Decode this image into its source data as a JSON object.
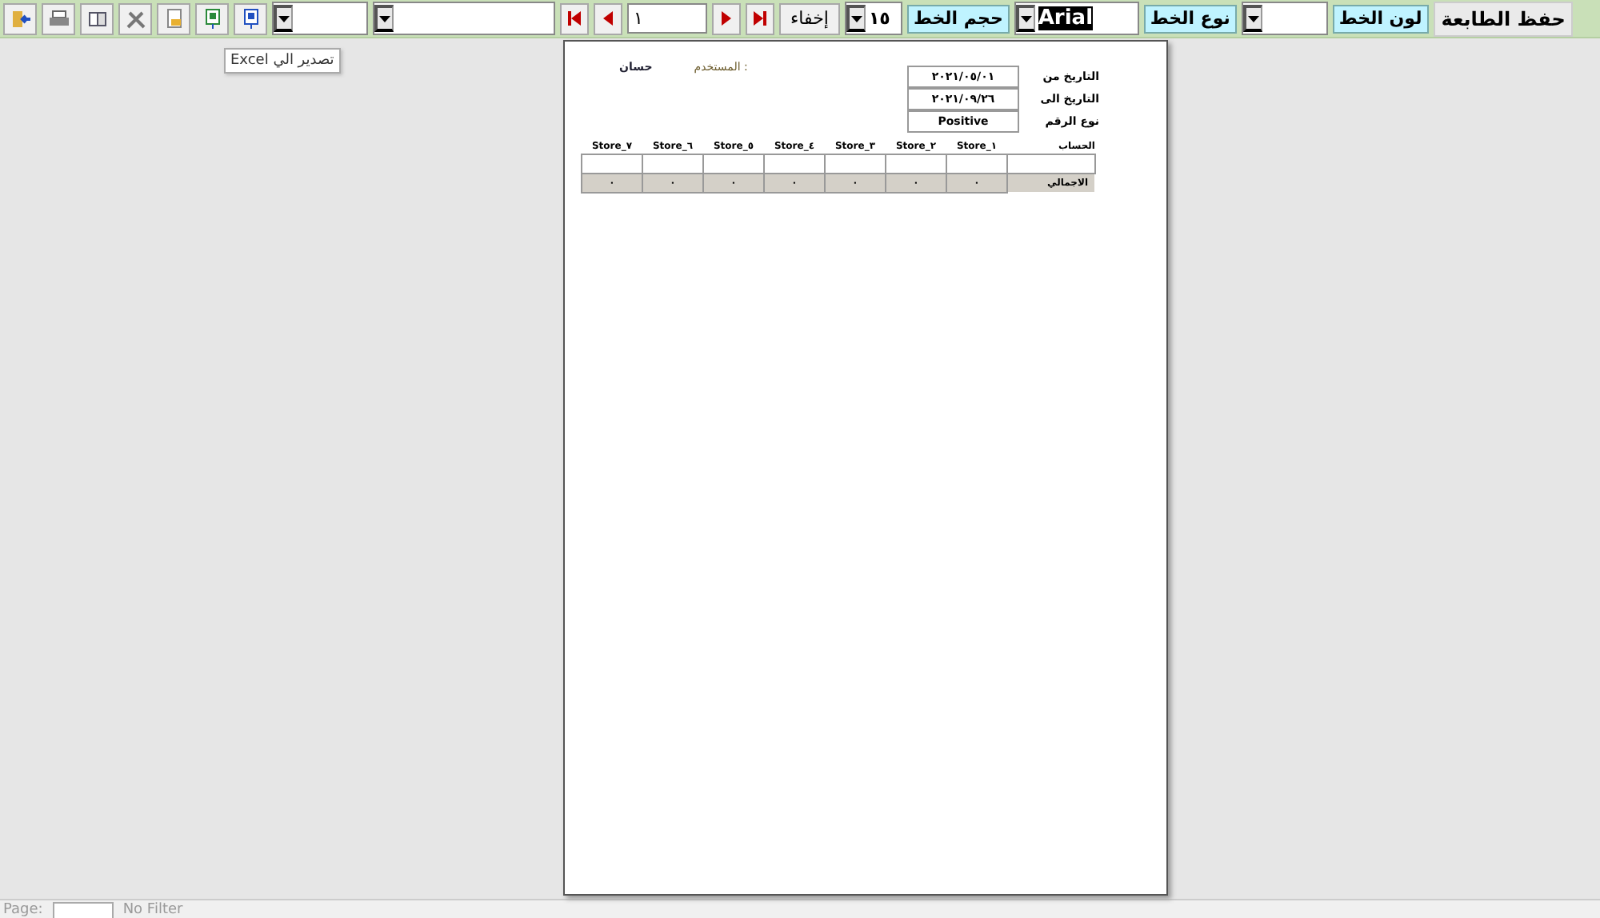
{
  "toolbar": {
    "record": "١",
    "hide_button": "إخفاء",
    "font_size": "١٥",
    "font_size_label": "حجم الخط",
    "font_name": "Arial",
    "font_name_label": "نوع الخط",
    "font_color_label": "لون الخط",
    "save_button": "حفظ الطابعة"
  },
  "tooltip": "تصدير الي Excel",
  "report": {
    "user_label": "المستخدم :",
    "user_name": "حسان",
    "params": [
      {
        "label": "التاريخ من",
        "value": "٢٠٢١/٠٥/٠١"
      },
      {
        "label": "التاريخ الى",
        "value": "٢٠٢١/٠٩/٢٦"
      },
      {
        "label": "نوع الرقم",
        "value": "Positive"
      }
    ],
    "columns": [
      "الحساب",
      "Store_١",
      "Store_٢",
      "Store_٣",
      "Store_٤",
      "Store_٥",
      "Store_٦",
      "Store_٧"
    ],
    "total_label": "الاجمالي",
    "totals": [
      "٠",
      "٠",
      "٠",
      "٠",
      "٠",
      "٠",
      "٠"
    ]
  },
  "status_bar": {
    "page_label": "Page:",
    "filter": "No Filter"
  }
}
